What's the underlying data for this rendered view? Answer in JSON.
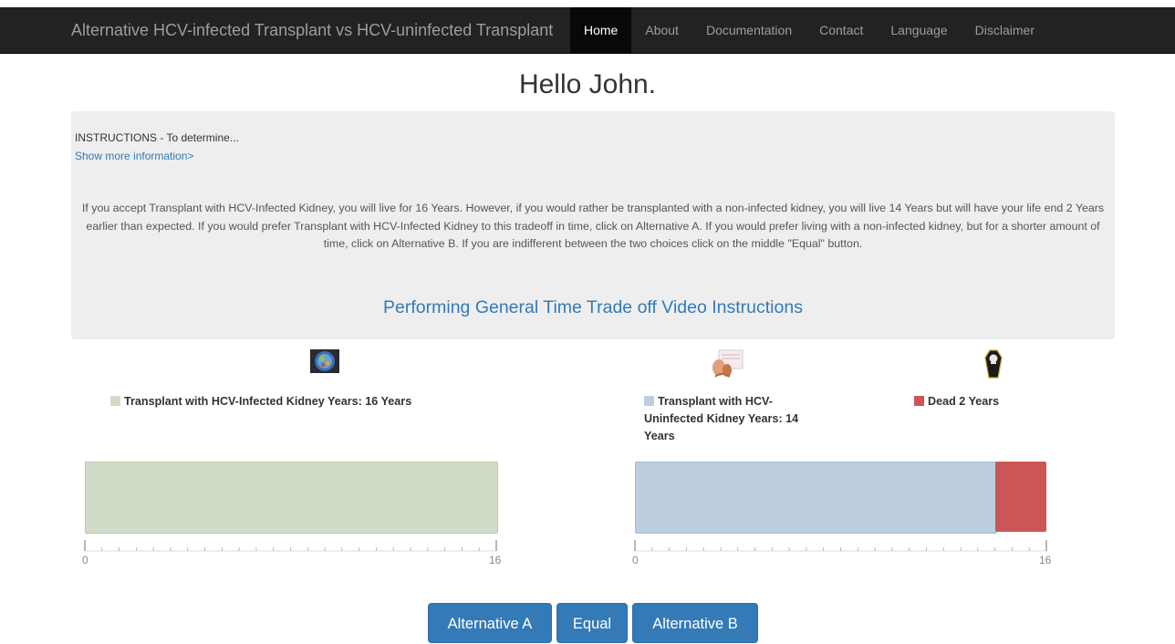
{
  "navbar": {
    "brand": "Alternative HCV-infected Transplant vs HCV-uninfected Transplant",
    "items": [
      "Home",
      "About",
      "Documentation",
      "Contact",
      "Language",
      "Disclaimer"
    ],
    "active": "Home"
  },
  "greeting": "Hello John.",
  "instructions": {
    "title": "INSTRUCTIONS - To determine...",
    "more_link": "Show more information>",
    "description": "If you accept Transplant with HCV-Infected Kidney, you will live for 16 Years. However, if you would rather be transplanted with a non-infected kidney, you will live 14 Years but will have your life end 2 Years earlier than expected. If you would prefer Transplant with HCV-Infected Kidney to this tradeoff in time, click on Alternative A. If you would prefer living with a non-infected kidney, but for a shorter amount of time, click on Alternative B. If you are indifferent between the two choices click on the middle \"Equal\" button.",
    "video_link": "Performing General Time Trade off Video Instructions"
  },
  "alternative_a": {
    "icon": "hcv-virus-icon",
    "legend": "Transplant with HCV-Infected Kidney Years: 16 Years",
    "years": 16,
    "color": "#d0dcc8",
    "axis": {
      "min": 0,
      "max": 16,
      "min_label": "0",
      "max_label": "16"
    }
  },
  "alternative_b": {
    "icon": "kidney-transplant-icon",
    "dead_icon": "coffin-icon",
    "legend_transplant": "Transplant with HCV-Uninfected Kidney Years: 14 Years",
    "legend_dead": "Dead 2 Years",
    "transplant_years": 14,
    "dead_years": 2,
    "transplant_color": "#bccedf",
    "dead_color": "#cc5555",
    "axis": {
      "min": 0,
      "max": 16,
      "min_label": "0",
      "max_label": "16"
    }
  },
  "buttons": {
    "alternative_a": "Alternative A",
    "equal": "Equal",
    "alternative_b": "Alternative B"
  }
}
